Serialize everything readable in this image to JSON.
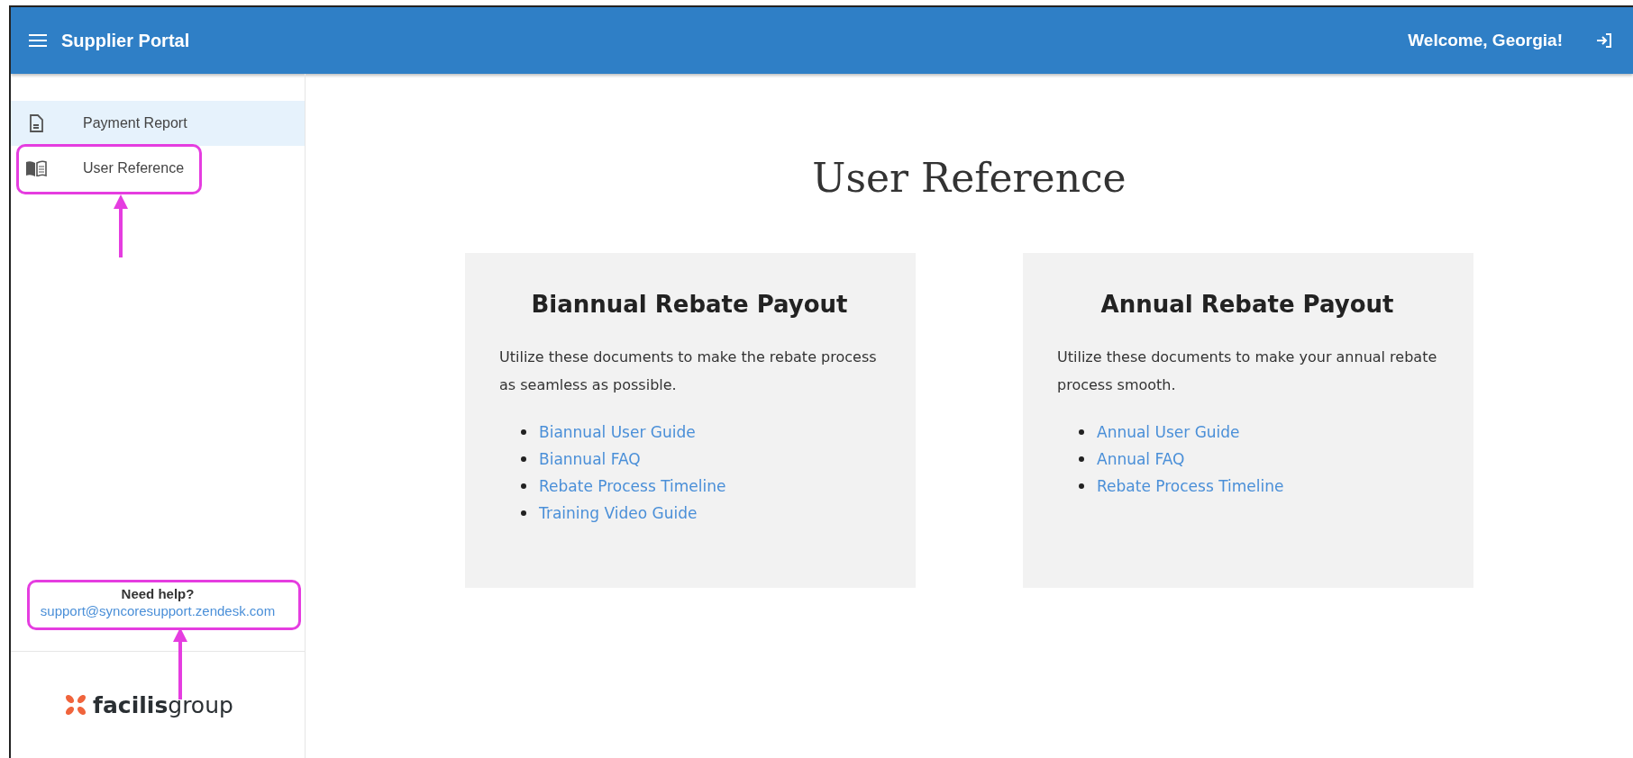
{
  "header": {
    "title": "Supplier Portal",
    "welcome": "Welcome, Georgia!"
  },
  "sidebar": {
    "items": [
      {
        "label": "Payment Report",
        "kind": "document",
        "selected": true,
        "highlighted": false
      },
      {
        "label": "User Reference",
        "kind": "book",
        "selected": false,
        "highlighted": true
      }
    ],
    "help": {
      "title": "Need help?",
      "email": "support@syncoresupport.zendesk.com",
      "highlighted": true
    },
    "logo": {
      "text": "**facilis**group"
    }
  },
  "page": {
    "title": "User Reference",
    "cards": [
      {
        "title": "Biannual Rebate Payout",
        "text": "Utilize these documents to make the rebate process as seamless as possible.",
        "links": [
          "Biannual User Guide",
          "Biannual FAQ",
          "Rebate Process Timeline",
          "Training Video Guide"
        ]
      },
      {
        "title": "Annual Rebate Payout",
        "text": "Utilize these documents to make your annual rebate process smooth.",
        "links": [
          "Annual User Guide",
          "Annual FAQ",
          "Rebate Process Timeline"
        ]
      }
    ]
  }
}
